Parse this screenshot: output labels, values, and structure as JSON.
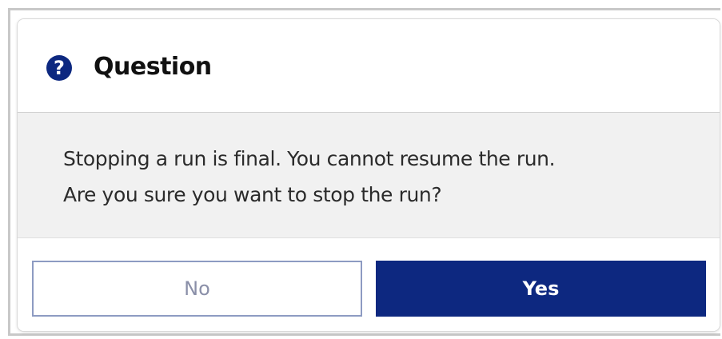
{
  "dialog": {
    "title": "Question",
    "icon": "question-circle-icon",
    "message_lines": [
      "Stopping a run is final. You cannot resume the run.",
      "Are you sure you want to stop the run?"
    ],
    "buttons": {
      "no_label": "No",
      "yes_label": "Yes"
    }
  },
  "colors": {
    "primary": "#0d2880",
    "body_background": "#f1f1f1",
    "secondary_border": "#8d9bc2"
  }
}
